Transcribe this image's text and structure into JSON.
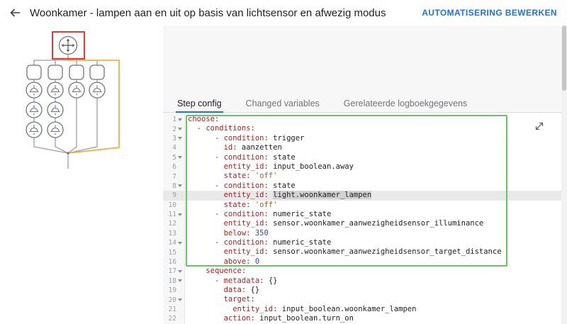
{
  "header": {
    "title": "Woonkamer - lampen aan en uit op basis van lichtsensor en afwezig modus",
    "action_label": "AUTOMATISERING BEWERKEN",
    "accent_color": "#1a73e8"
  },
  "tabs": [
    {
      "label": "Step config",
      "active": true
    },
    {
      "label": "Changed variables",
      "active": false
    },
    {
      "label": "Gerelateerde logboekgegevens",
      "active": false
    }
  ],
  "graph": {
    "selected_node": "root-move-node",
    "selection_color": "#e53935",
    "active_path_color": "#f7a32a",
    "node_outline_color": "#757575",
    "line_color": "#9e9e9e",
    "columns": [
      {
        "lamps": 3
      },
      {
        "lamps": 3
      },
      {
        "lamps": 1
      },
      {
        "lamps": 1
      }
    ]
  },
  "editor": {
    "language": "yaml",
    "active_line": 9,
    "selected_token": {
      "line": 9,
      "text": "light.woonkamer_lampen"
    },
    "highlight_box": {
      "from_line": 1,
      "to_line": 16,
      "color": "#67c662"
    },
    "fold_lines": [
      1,
      2,
      3,
      5,
      8,
      11,
      14,
      17,
      18,
      20
    ],
    "expand_icon": "expand-diagonal-icon",
    "lines": [
      "choose:",
      "  - conditions:",
      "      - condition: trigger",
      "        id: aanzetten",
      "      - condition: state",
      "        entity_id: input_boolean.away",
      "        state: 'off'",
      "      - condition: state",
      "        entity_id: light.woonkamer_lampen",
      "        state: 'off'",
      "      - condition: numeric_state",
      "        entity_id: sensor.woonkamer_aanwezigheidsensor_illuminance",
      "        below: 350",
      "      - condition: numeric_state",
      "        entity_id: sensor.woonkamer_aanwezigheidsensor_target_distance",
      "        above: 0",
      "    sequence:",
      "      - metadata: {}",
      "        data: {}",
      "        target:",
      "          entity_id: input_boolean.woonkamer_lampen",
      "        action: input_boolean.turn_on"
    ]
  }
}
